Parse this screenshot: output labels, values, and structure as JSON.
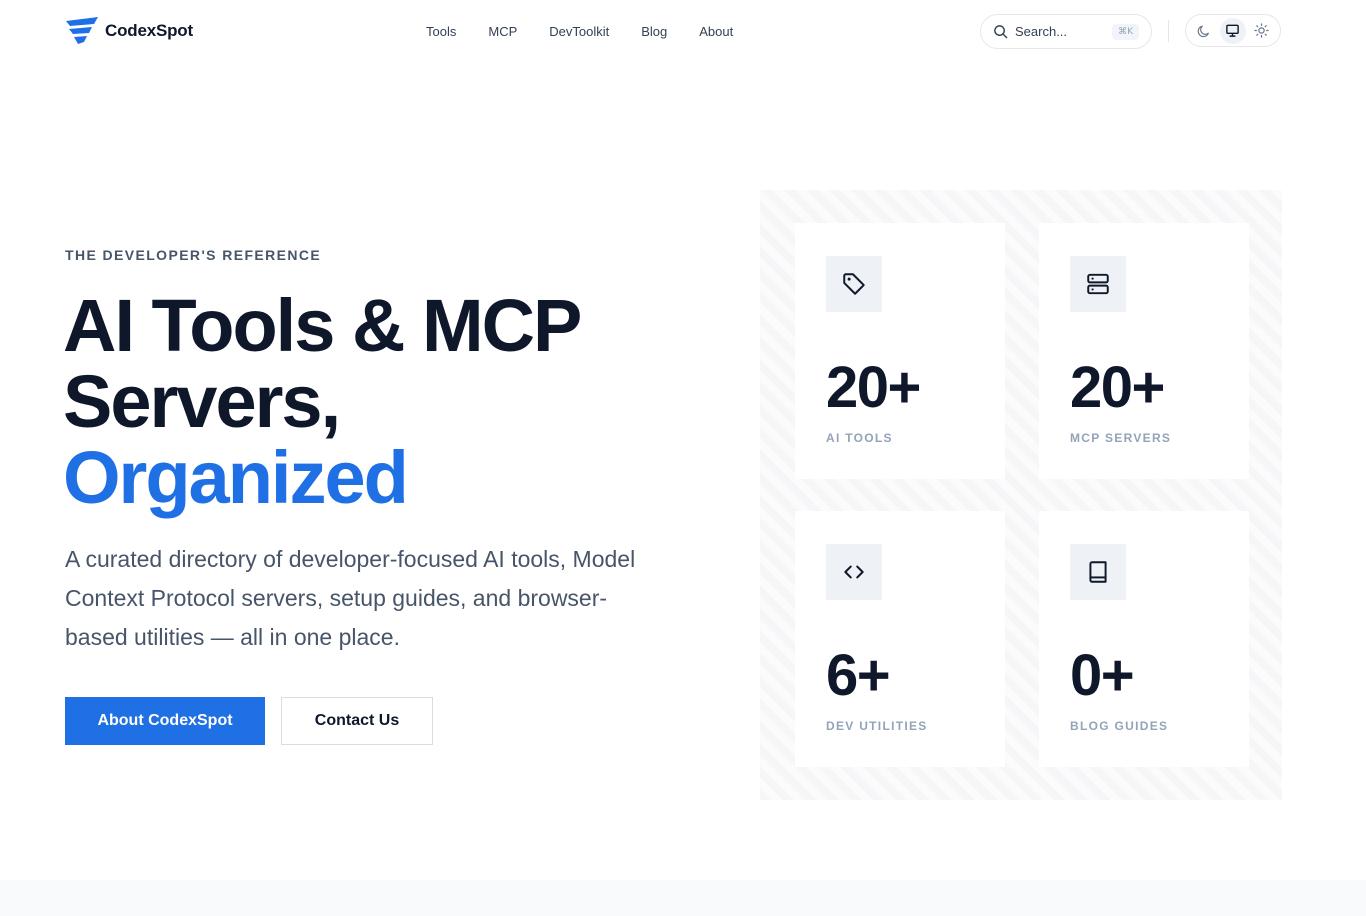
{
  "brand": {
    "name": "CodexSpot",
    "accent": "#1f6fe5"
  },
  "nav": {
    "items": [
      "Tools",
      "MCP",
      "DevToolkit",
      "Blog",
      "About"
    ]
  },
  "search": {
    "placeholder": "Search...",
    "shortcut": "⌘K"
  },
  "theme_toggle": {
    "options": [
      "moon-icon",
      "monitor-icon",
      "sun-icon"
    ],
    "active": "monitor-icon"
  },
  "hero": {
    "eyebrow": "THE DEVELOPER'S REFERENCE",
    "title_line1": "AI Tools & MCP",
    "title_line2": "Servers,",
    "title_accent": "Organized",
    "lead": "A curated directory of developer-focused AI tools, Model Context Protocol servers, setup guides, and browser-based utilities — all in one place.",
    "primary_cta": "About CodexSpot",
    "secondary_cta": "Contact Us"
  },
  "stats": [
    {
      "icon": "tag-icon",
      "value": "20+",
      "label": "AI TOOLS"
    },
    {
      "icon": "server-icon",
      "value": "20+",
      "label": "MCP SERVERS"
    },
    {
      "icon": "code-icon",
      "value": "6+",
      "label": "DEV UTILITIES"
    },
    {
      "icon": "book-icon",
      "value": "0+",
      "label": "BLOG GUIDES"
    }
  ]
}
